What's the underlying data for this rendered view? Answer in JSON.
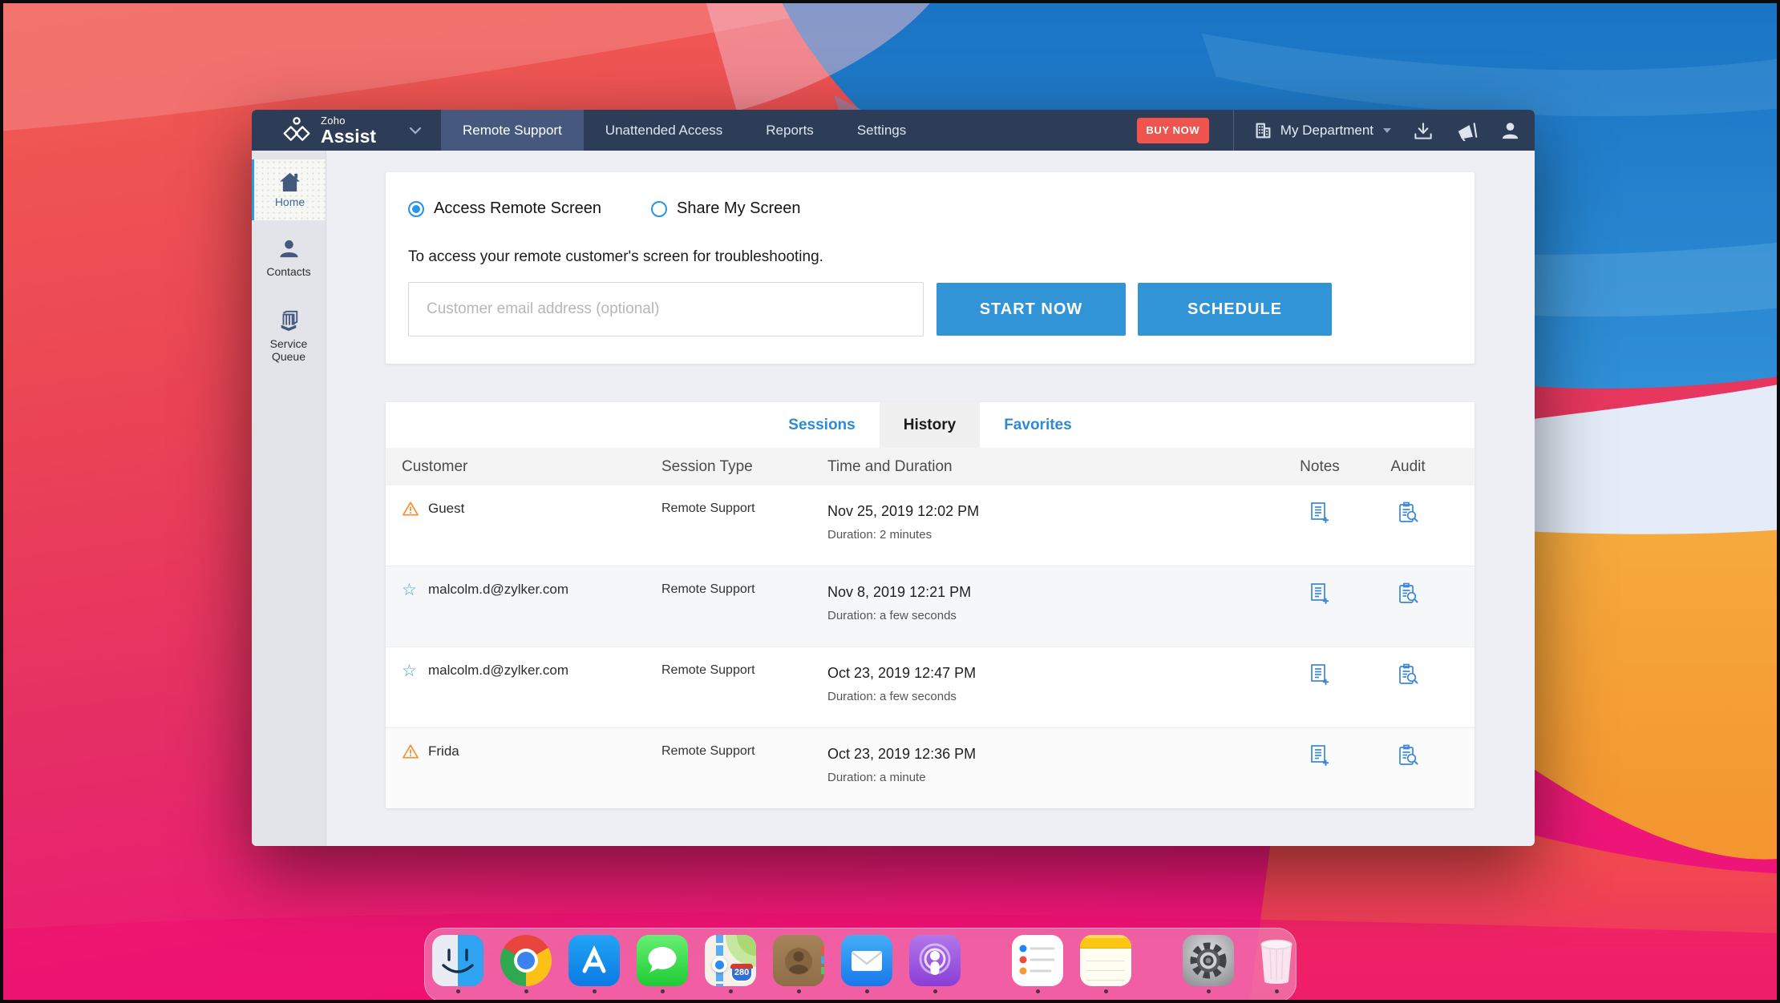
{
  "app": {
    "brand": {
      "zoho": "Zoho",
      "assist": "Assist"
    },
    "nav": [
      "Remote Support",
      "Unattended Access",
      "Reports",
      "Settings"
    ],
    "buy_now": "BUY NOW",
    "department": "My Department"
  },
  "sidebar": {
    "items": [
      {
        "label": "Home"
      },
      {
        "label": "Contacts"
      },
      {
        "label": "Service Queue"
      }
    ]
  },
  "session_panel": {
    "radio_access": "Access Remote Screen",
    "radio_share": "Share My Screen",
    "description": "To access your remote customer's screen for troubleshooting.",
    "email_placeholder": "Customer email address (optional)",
    "start_button": "START NOW",
    "schedule_button": "SCHEDULE"
  },
  "history": {
    "tabs": [
      "Sessions",
      "History",
      "Favorites"
    ],
    "active_tab": "History",
    "columns": [
      "Customer",
      "Session Type",
      "Time and Duration",
      "Notes",
      "Audit"
    ],
    "rows": [
      {
        "flag": "warning",
        "customer": "Guest",
        "session_type": "Remote Support",
        "time": "Nov 25, 2019 12:02 PM",
        "duration": "Duration: 2 minutes"
      },
      {
        "flag": "star",
        "customer": "malcolm.d@zylker.com",
        "session_type": "Remote Support",
        "time": "Nov 8, 2019 12:21 PM",
        "duration": "Duration: a few seconds"
      },
      {
        "flag": "star",
        "customer": "malcolm.d@zylker.com",
        "session_type": "Remote Support",
        "time": "Oct 23, 2019 12:47 PM",
        "duration": "Duration: a few seconds"
      },
      {
        "flag": "warning",
        "customer": "Frida",
        "session_type": "Remote Support",
        "time": "Oct 23, 2019 12:36 PM",
        "duration": "Duration: a minute"
      }
    ]
  },
  "dock": {
    "apps": [
      "finder",
      "chrome",
      "app-store",
      "messages",
      "maps",
      "contacts",
      "mail",
      "podcasts",
      "reminders",
      "notes",
      "system-preferences",
      "trash"
    ],
    "maps_badge": "280",
    "star_glyph": "☆"
  },
  "colors": {
    "navbar": "#2d3d57",
    "nav_active": "#47587e",
    "accent_blue": "#3094d6",
    "buy_now_red": "#ef554e",
    "link_blue": "#2e8ad6",
    "warning_orange": "#f0973f",
    "sidebar_active_border": "#2b99e8"
  }
}
